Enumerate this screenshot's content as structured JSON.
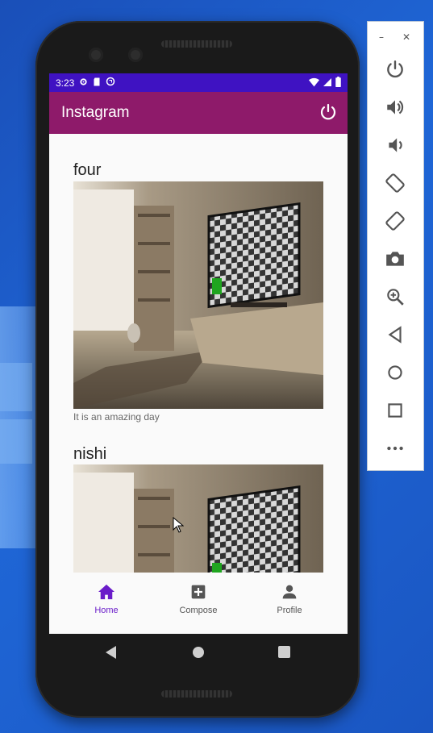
{
  "status_bar": {
    "time": "3:23"
  },
  "app_bar": {
    "title": "Instagram"
  },
  "posts": [
    {
      "user": "four",
      "caption": "It is an amazing day"
    },
    {
      "user": "nishi",
      "caption": ""
    }
  ],
  "bottom_nav": [
    {
      "label": "Home",
      "icon": "home-icon",
      "active": true
    },
    {
      "label": "Compose",
      "icon": "add-box-icon",
      "active": false
    },
    {
      "label": "Profile",
      "icon": "person-icon",
      "active": false
    }
  ],
  "emulator_panel": {
    "tools": [
      "power-icon",
      "volume-up-icon",
      "volume-down-icon",
      "rotate-left-icon",
      "rotate-right-icon",
      "camera-icon",
      "zoom-icon",
      "back-icon",
      "home-icon",
      "overview-icon",
      "more-icon"
    ]
  },
  "colors": {
    "status_bar": "#3f12c2",
    "app_bar": "#8e1a6a",
    "nav_active": "#6a1cc9"
  }
}
